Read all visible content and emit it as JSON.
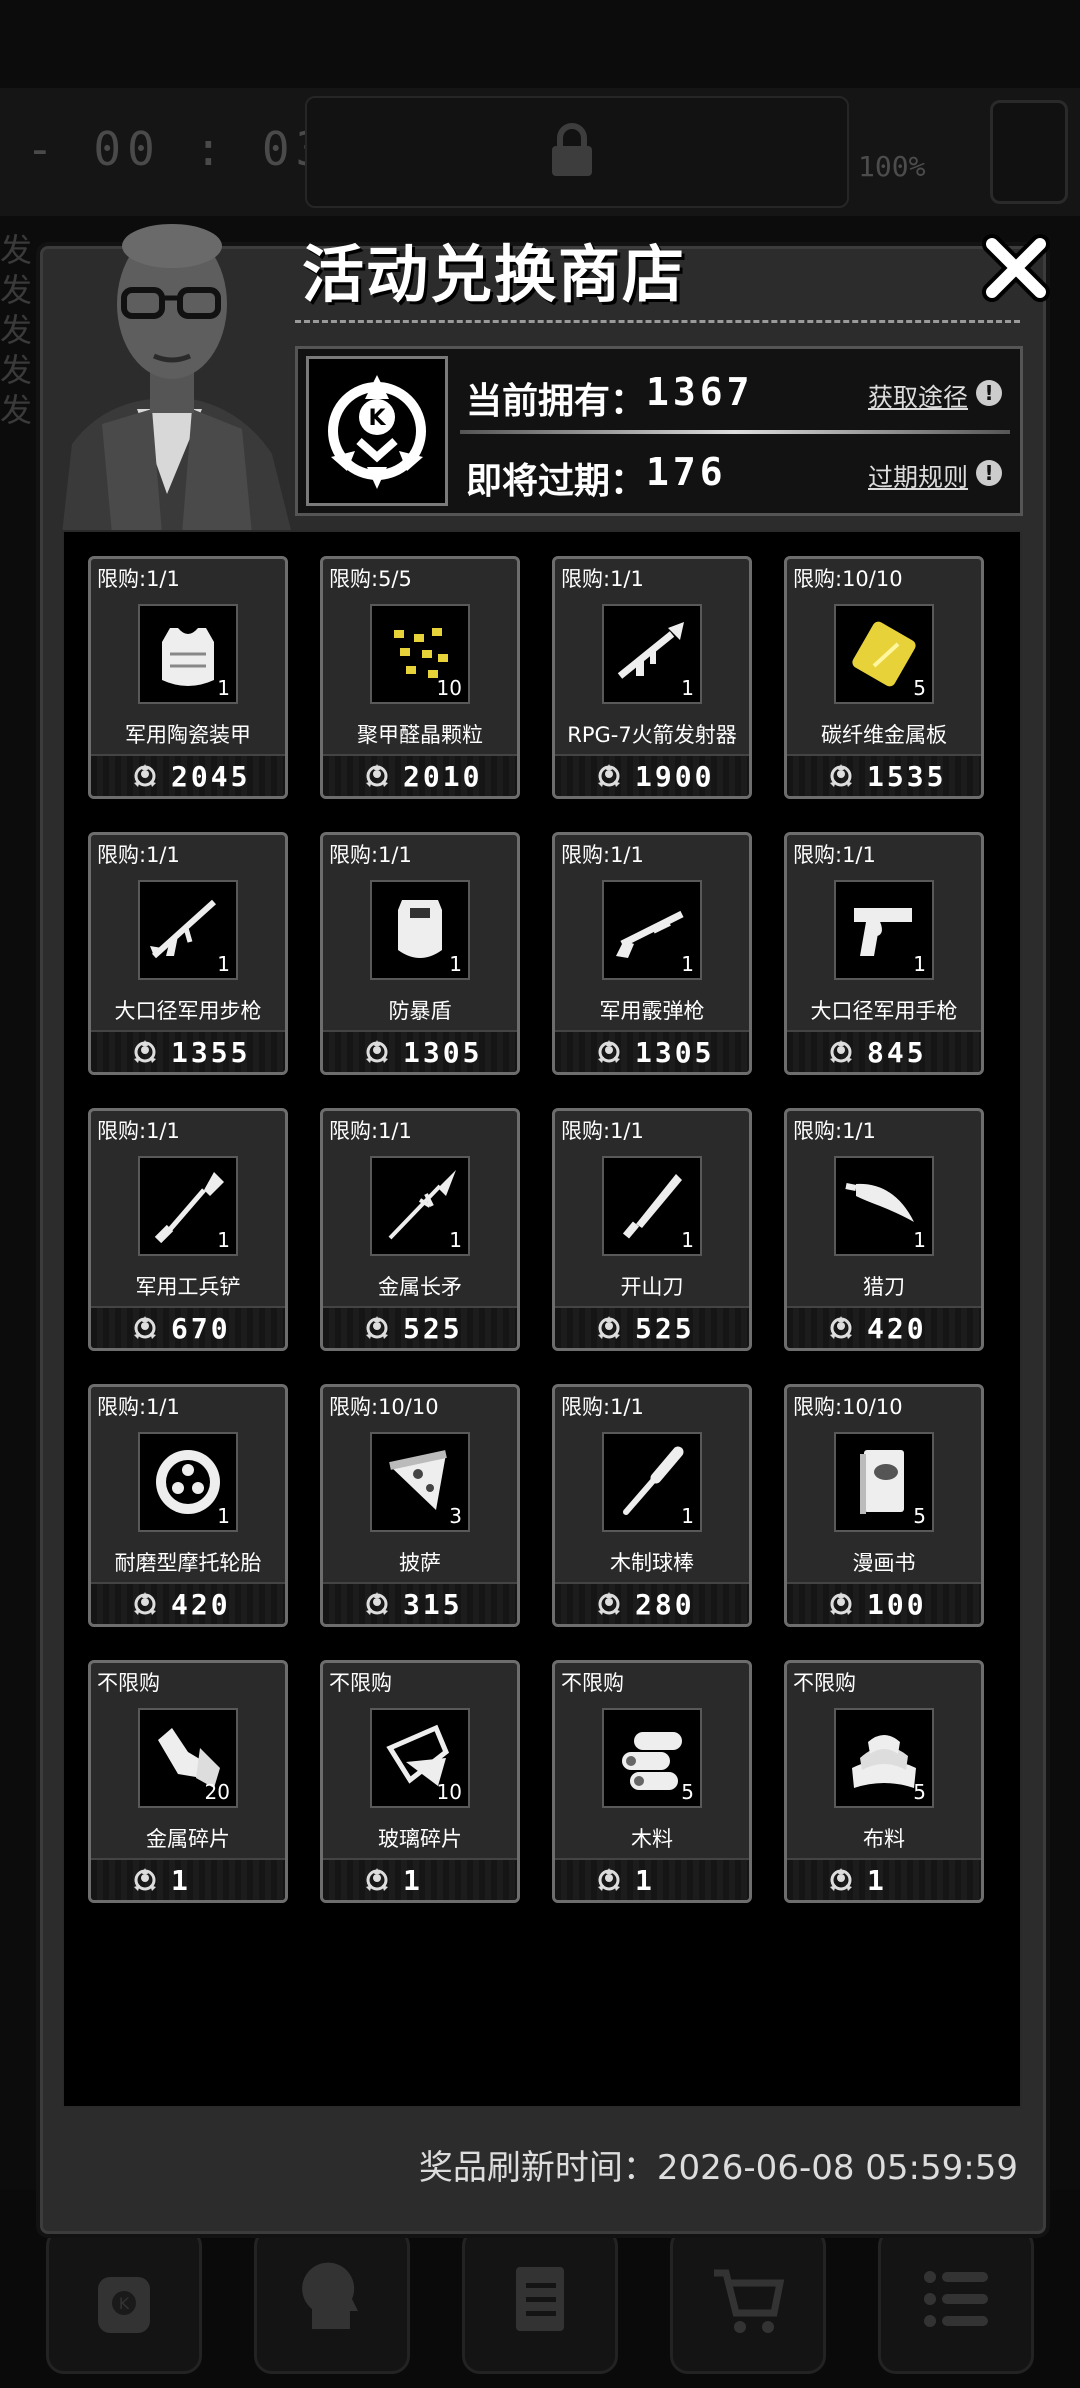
{
  "hud": {
    "timer": "- 00 : 03 -",
    "percent": "100%"
  },
  "background_side_text": [
    "发",
    "发",
    "发",
    "发",
    "发"
  ],
  "shop": {
    "title": "活动兑换商店",
    "owned_label": "当前拥有：",
    "owned_value": "1367",
    "expiring_label": "即将过期：",
    "expiring_value": "176",
    "obtain_link": "获取途径",
    "expire_rules_link": "过期规则",
    "refresh_label": "奖品刷新时间：",
    "refresh_time": "2026-06-08 05:59:59"
  },
  "items": [
    {
      "limit": "限购:1/1",
      "name": "军用陶瓷装甲",
      "qty": "1",
      "price": "2045",
      "icon": "ceramic-armor-icon"
    },
    {
      "limit": "限购:5/5",
      "name": "聚甲醛晶颗粒",
      "qty": "10",
      "price": "2010",
      "icon": "pellets-icon"
    },
    {
      "limit": "限购:1/1",
      "name": "RPG-7火箭发射器",
      "qty": "1",
      "price": "1900",
      "icon": "rocket-launcher-icon"
    },
    {
      "limit": "限购:10/10",
      "name": "碳纤维金属板",
      "qty": "5",
      "price": "1535",
      "icon": "metal-plate-icon"
    },
    {
      "limit": "限购:1/1",
      "name": "大口径军用步枪",
      "qty": "1",
      "price": "1355",
      "icon": "rifle-icon"
    },
    {
      "limit": "限购:1/1",
      "name": "防暴盾",
      "qty": "1",
      "price": "1305",
      "icon": "riot-shield-icon"
    },
    {
      "limit": "限购:1/1",
      "name": "军用霰弹枪",
      "qty": "1",
      "price": "1305",
      "icon": "shotgun-icon"
    },
    {
      "limit": "限购:1/1",
      "name": "大口径军用手枪",
      "qty": "1",
      "price": "845",
      "icon": "pistol-icon"
    },
    {
      "limit": "限购:1/1",
      "name": "军用工兵铲",
      "qty": "1",
      "price": "670",
      "icon": "shovel-icon"
    },
    {
      "limit": "限购:1/1",
      "name": "金属长矛",
      "qty": "1",
      "price": "525",
      "icon": "spear-icon"
    },
    {
      "limit": "限购:1/1",
      "name": "开山刀",
      "qty": "1",
      "price": "525",
      "icon": "machete-icon"
    },
    {
      "limit": "限购:1/1",
      "name": "猎刀",
      "qty": "1",
      "price": "420",
      "icon": "kukri-icon"
    },
    {
      "limit": "限购:1/1",
      "name": "耐磨型摩托轮胎",
      "qty": "1",
      "price": "420",
      "icon": "tire-icon"
    },
    {
      "limit": "限购:10/10",
      "name": "披萨",
      "qty": "3",
      "price": "315",
      "icon": "pizza-icon"
    },
    {
      "limit": "限购:1/1",
      "name": "木制球棒",
      "qty": "1",
      "price": "280",
      "icon": "bat-icon"
    },
    {
      "limit": "限购:10/10",
      "name": "漫画书",
      "qty": "5",
      "price": "100",
      "icon": "comic-book-icon"
    },
    {
      "limit": "不限购",
      "name": "金属碎片",
      "qty": "20",
      "price": "1",
      "icon": "metal-scrap-icon"
    },
    {
      "limit": "不限购",
      "name": "玻璃碎片",
      "qty": "10",
      "price": "1",
      "icon": "glass-shard-icon"
    },
    {
      "limit": "不限购",
      "name": "木料",
      "qty": "5",
      "price": "1",
      "icon": "wood-logs-icon"
    },
    {
      "limit": "不限购",
      "name": "布料",
      "qty": "5",
      "price": "1",
      "icon": "cloth-icon"
    }
  ],
  "colors": {
    "panel": "#2c2c2c",
    "card_border": "#6d6d6d",
    "accent_yellow": "#e8d23a"
  }
}
